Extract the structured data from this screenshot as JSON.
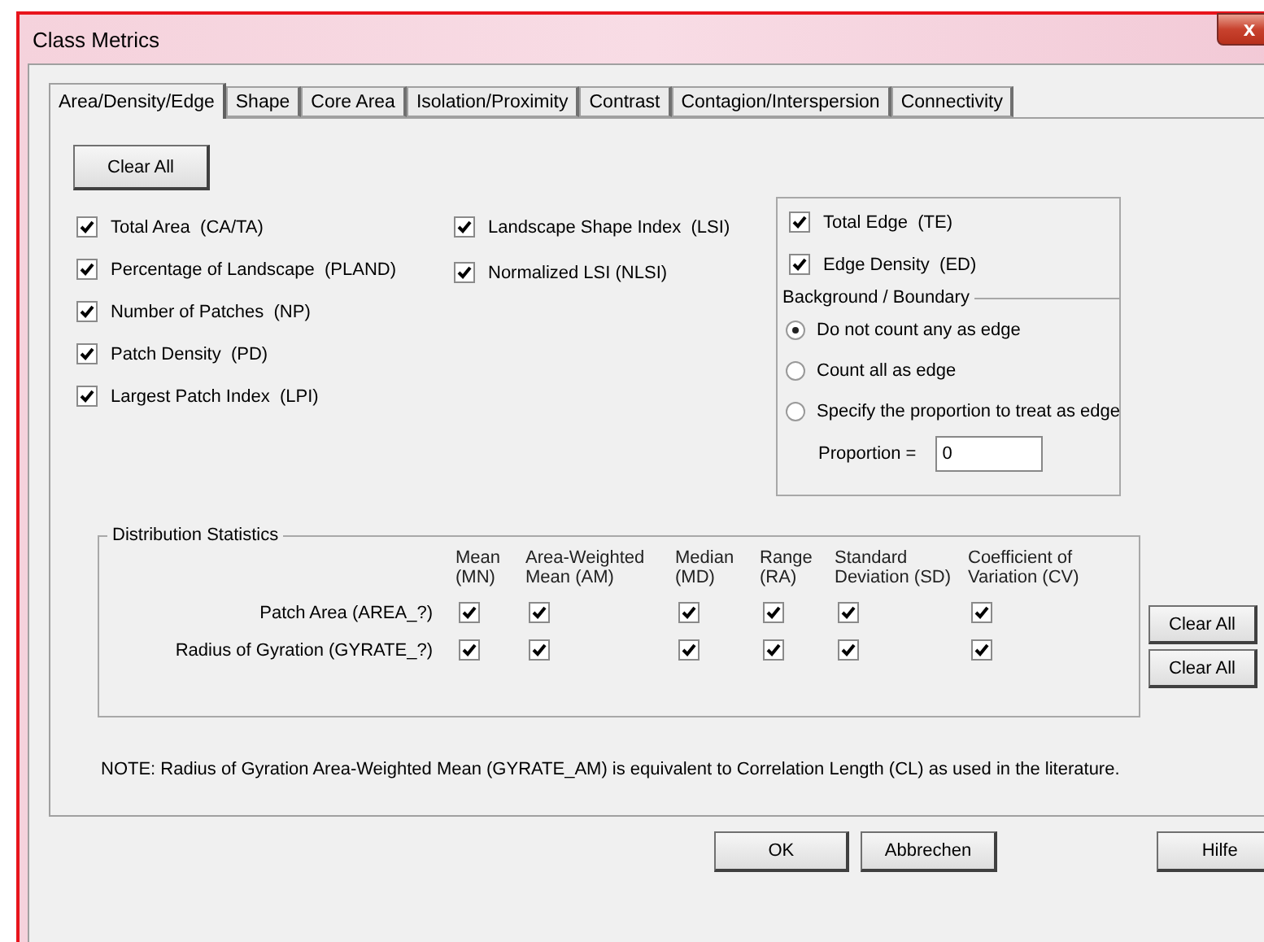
{
  "window": {
    "title": "Class Metrics",
    "close": "x"
  },
  "tabs": [
    {
      "label": "Area/Density/Edge",
      "selected": true
    },
    {
      "label": "Shape",
      "selected": false
    },
    {
      "label": "Core Area",
      "selected": false
    },
    {
      "label": "Isolation/Proximity",
      "selected": false
    },
    {
      "label": "Contrast",
      "selected": false
    },
    {
      "label": "Contagion/Interspersion",
      "selected": false
    },
    {
      "label": "Connectivity",
      "selected": false
    }
  ],
  "clear_all": "Clear All",
  "metrics_left": [
    {
      "label": "Total Area  (CA/TA)",
      "checked": true
    },
    {
      "label": "Percentage of Landscape  (PLAND)",
      "checked": true
    },
    {
      "label": "Number of Patches  (NP)",
      "checked": true
    },
    {
      "label": "Patch Density  (PD)",
      "checked": true
    },
    {
      "label": "Largest Patch Index  (LPI)",
      "checked": true
    }
  ],
  "metrics_middle": [
    {
      "label": "Landscape Shape Index  (LSI)",
      "checked": true
    },
    {
      "label": "Normalized LSI (NLSI)",
      "checked": true
    }
  ],
  "edge_metrics": [
    {
      "label": "Total Edge  (TE)",
      "checked": true
    },
    {
      "label": "Edge Density  (ED)",
      "checked": true
    }
  ],
  "boundary": {
    "title": "Background / Boundary",
    "options": [
      {
        "label": "Do not count any as edge",
        "selected": true
      },
      {
        "label": "Count all as edge",
        "selected": false
      },
      {
        "label": "Specify the proportion to treat as edge",
        "selected": false
      }
    ],
    "proportion": {
      "label": "Proportion =",
      "value": "0"
    }
  },
  "distribution": {
    "title": "Distribution Statistics",
    "columns": [
      {
        "lines": [
          "Mean",
          "(MN)"
        ]
      },
      {
        "lines": [
          "Area-Weighted",
          "Mean (AM)"
        ]
      },
      {
        "lines": [
          "Median",
          "(MD)"
        ]
      },
      {
        "lines": [
          "Range",
          "(RA)"
        ]
      },
      {
        "lines": [
          "Standard",
          "Deviation (SD)"
        ]
      },
      {
        "lines": [
          "Coefficient of",
          "Variation (CV)"
        ]
      }
    ],
    "rows": [
      {
        "label": "Patch Area (AREA_?)",
        "checks": [
          true,
          true,
          true,
          true,
          true,
          true
        ],
        "clear": "Clear All"
      },
      {
        "label": "Radius of Gyration (GYRATE_?)",
        "checks": [
          true,
          true,
          true,
          true,
          true,
          true
        ],
        "clear": "Clear All"
      }
    ]
  },
  "note": "NOTE: Radius of Gyration Area-Weighted Mean (GYRATE_AM) is equivalent to Correlation Length (CL) as used in the literature.",
  "buttons": [
    {
      "label": "OK",
      "kind": "ok"
    },
    {
      "label": "Abbrechen",
      "kind": "cancel"
    },
    {
      "label": "Hilfe",
      "kind": "help"
    }
  ]
}
